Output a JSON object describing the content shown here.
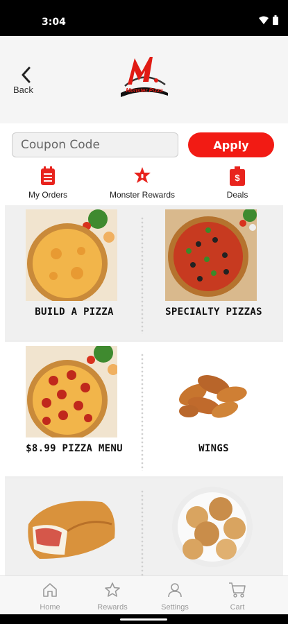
{
  "status": {
    "time": "3:04"
  },
  "header": {
    "back_label": "Back",
    "logo_text": "Monster Pizza"
  },
  "coupon": {
    "placeholder": "Coupon Code",
    "apply_label": "Apply"
  },
  "quick_links": [
    {
      "label": "My Orders",
      "icon": "orders-icon"
    },
    {
      "label": "Monster Rewards",
      "icon": "rewards-badge-icon"
    },
    {
      "label": "Deals",
      "icon": "deals-tag-icon"
    }
  ],
  "menu": [
    {
      "title": "BUILD A PIZZA",
      "image": "cheese-pizza"
    },
    {
      "title": "SPECIALTY PIZZAS",
      "image": "supreme-pizza"
    },
    {
      "title": "$8.99 PIZZA MENU",
      "image": "pepperoni-pizza"
    },
    {
      "title": "WINGS",
      "image": "chicken-wings"
    },
    {
      "title": "",
      "image": "calzone"
    },
    {
      "title": "",
      "image": "garlic-knots"
    }
  ],
  "nav": [
    {
      "label": "Home",
      "icon": "home-icon"
    },
    {
      "label": "Rewards",
      "icon": "star-icon"
    },
    {
      "label": "Settings",
      "icon": "user-icon"
    },
    {
      "label": "Cart",
      "icon": "cart-icon"
    }
  ],
  "colors": {
    "accent": "#f21b14",
    "header_bg": "#f5f5f5",
    "nav_icon": "#9a9a9a"
  }
}
